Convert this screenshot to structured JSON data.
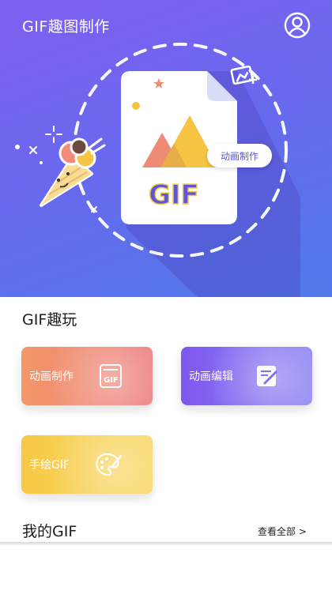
{
  "header": {
    "title": "GIF趣图制作",
    "profile_icon": "user-icon"
  },
  "hero": {
    "badge_label": "动画制作",
    "doc_text": "GIF"
  },
  "fun_section": {
    "title": "GIF趣玩",
    "cards": [
      {
        "label": "动画制作",
        "icon": "gif-file-icon",
        "color": "#ef8a74"
      },
      {
        "label": "动画编辑",
        "icon": "edit-note-icon",
        "color": "#8570f0"
      },
      {
        "label": "手绘GIF",
        "icon": "palette-icon",
        "color": "#f7cf55"
      }
    ]
  },
  "my_section": {
    "title": "我的GIF",
    "view_all": "查看全部 >"
  },
  "colors": {
    "hero_start": "#7f5ff0",
    "hero_end": "#4f79ea",
    "accent": "#5b57d6"
  }
}
